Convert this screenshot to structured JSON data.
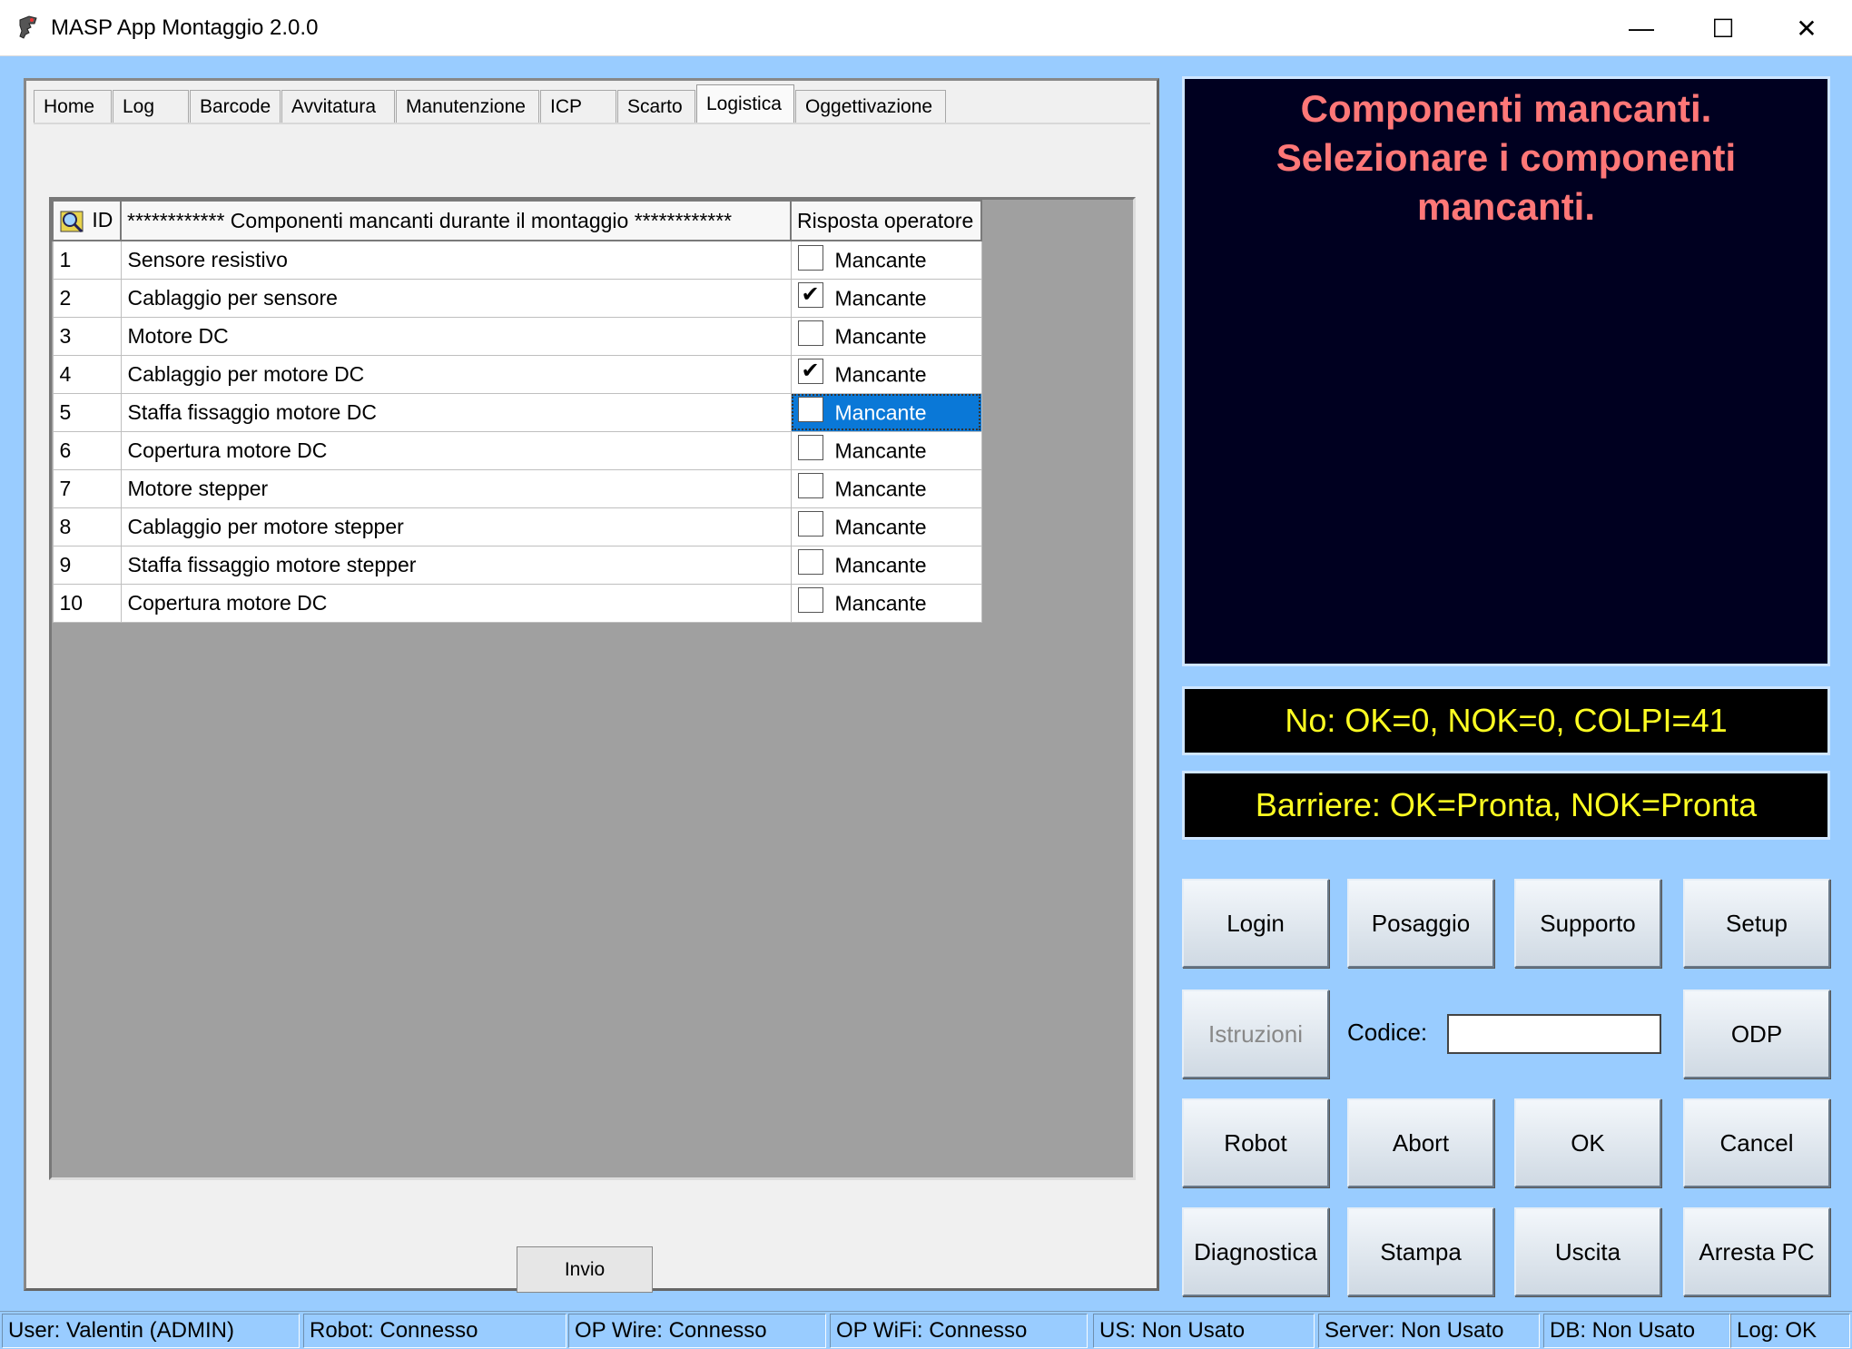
{
  "window": {
    "title": "MASP App Montaggio 2.0.0",
    "min_glyph": "—",
    "max_glyph": "☐",
    "close_glyph": "✕"
  },
  "tabs": [
    {
      "label": "Home"
    },
    {
      "label": "Log"
    },
    {
      "label": "Barcode"
    },
    {
      "label": "Avvitatura"
    },
    {
      "label": "Manutenzione"
    },
    {
      "label": "ICP"
    },
    {
      "label": "Scarto"
    },
    {
      "label": "Logistica",
      "active": true
    },
    {
      "label": "Oggettivazione"
    }
  ],
  "grid": {
    "headers": {
      "id": "ID",
      "component": "************ Componenti mancanti durante il montaggio ************",
      "response": "Risposta operatore"
    },
    "rows": [
      {
        "id": "1",
        "component": "Sensore resistivo",
        "checked": false,
        "label": "Mancante"
      },
      {
        "id": "2",
        "component": "Cablaggio per sensore",
        "checked": true,
        "label": "Mancante"
      },
      {
        "id": "3",
        "component": "Motore DC",
        "checked": false,
        "label": "Mancante"
      },
      {
        "id": "4",
        "component": "Cablaggio per motore DC",
        "checked": true,
        "label": "Mancante"
      },
      {
        "id": "5",
        "component": "Staffa fissaggio motore DC",
        "checked": false,
        "label": "Mancante",
        "selected": true
      },
      {
        "id": "6",
        "component": "Copertura motore DC",
        "checked": false,
        "label": "Mancante"
      },
      {
        "id": "7",
        "component": "Motore stepper",
        "checked": false,
        "label": "Mancante"
      },
      {
        "id": "8",
        "component": "Cablaggio per motore stepper",
        "checked": false,
        "label": "Mancante"
      },
      {
        "id": "9",
        "component": "Staffa fissaggio motore stepper",
        "checked": false,
        "label": "Mancante"
      },
      {
        "id": "10",
        "component": "Copertura motore DC",
        "checked": false,
        "label": "Mancante"
      }
    ]
  },
  "invio_label": "Invio",
  "message": {
    "line1": "Componenti mancanti.",
    "line2": "Selezionare i componenti",
    "line3": "mancanti."
  },
  "counters": {
    "ok_nok": "No: OK=0, NOK=0, COLPI=41",
    "barriere": "Barriere: OK=Pronta, NOK=Pronta"
  },
  "buttons": {
    "login": "Login",
    "posaggio": "Posaggio",
    "supporto": "Supporto",
    "setup": "Setup",
    "istruzioni": "Istruzioni",
    "odp": "ODP",
    "robot": "Robot",
    "abort": "Abort",
    "ok": "OK",
    "cancel": "Cancel",
    "diagnostica": "Diagnostica",
    "stampa": "Stampa",
    "uscita": "Uscita",
    "arresta_pc": "Arresta PC"
  },
  "codice": {
    "label": "Codice:",
    "value": ""
  },
  "status": {
    "user": "User: Valentin (ADMIN)",
    "robot": "Robot: Connesso",
    "op_wire": "OP Wire: Connesso",
    "op_wifi": "OP WiFi: Connesso",
    "us": "US: Non Usato",
    "server": "Server: Non Usato",
    "db": "DB: Non Usato",
    "log": "Log: OK"
  }
}
